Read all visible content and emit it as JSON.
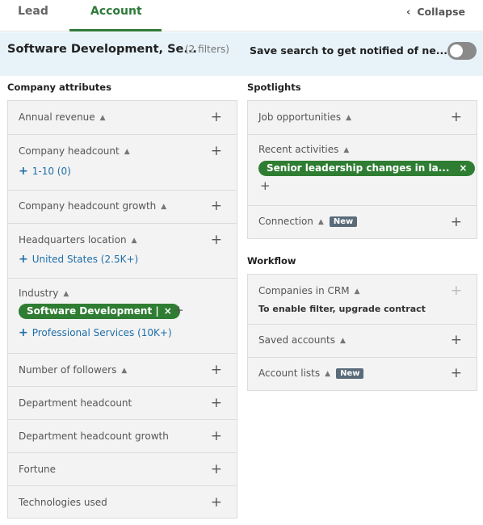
{
  "tabs": {
    "lead": "Lead",
    "account": "Account",
    "collapse": "Collapse"
  },
  "banner": {
    "title": "Software Development, Se...",
    "filters": "(2 filters)",
    "save_text": "Save search to get notified of ne...",
    "toggle_on": false
  },
  "company": {
    "heading": "Company attributes",
    "annual_revenue": "Annual revenue",
    "headcount": "Company headcount",
    "headcount_value": "1-10 (0)",
    "headcount_growth": "Company headcount growth",
    "hq": "Headquarters location",
    "hq_value": "United States (2.5K+)",
    "industry": "Industry",
    "industry_pill": "Software Development |",
    "industry_suggest": "Professional Services (10K+)",
    "followers": "Number of followers",
    "dept_headcount": "Department headcount",
    "dept_headcount_growth": "Department headcount growth",
    "fortune": "Fortune",
    "technologies": "Technologies used"
  },
  "spotlights": {
    "heading": "Spotlights",
    "job_opps": "Job opportunities",
    "recent": "Recent activities",
    "recent_pill": "Senior leadership changes in la...",
    "connection": "Connection",
    "new_badge": "New"
  },
  "workflow": {
    "heading": "Workflow",
    "crm": "Companies in CRM",
    "crm_note": "To enable filter, upgrade contract",
    "saved": "Saved accounts",
    "lists": "Account lists",
    "new_badge": "New"
  },
  "icons": {
    "plus": "+",
    "pin": "pushpin-icon",
    "close": "×",
    "chevron": "‹"
  },
  "colors": {
    "accent": "#2f7a3a",
    "pill": "#2e7d32",
    "link": "#1e6fa8",
    "banner_bg": "#e7f2f9"
  }
}
